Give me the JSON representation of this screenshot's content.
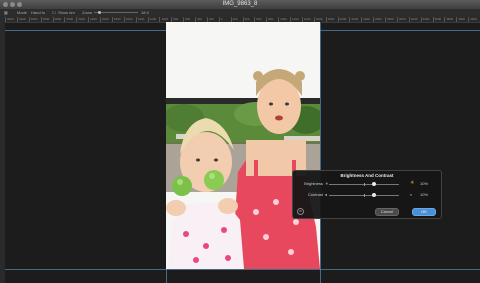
{
  "window": {
    "title": "IMG_9863_8"
  },
  "toolbar": {
    "mode_label": "Mode",
    "mode_value": "Hand to",
    "show_label": "Show rim",
    "zoom_label": "Zoom",
    "zoom_value": "18.9"
  },
  "ruler": {
    "ticks": [
      "3600",
      "3400",
      "3200",
      "3000",
      "2800",
      "2600",
      "2400",
      "2200",
      "2000",
      "1800",
      "1600",
      "1400",
      "1200",
      "1000",
      "800",
      "600",
      "400",
      "200",
      "0",
      "200",
      "400",
      "600",
      "800",
      "1000",
      "1200",
      "1400",
      "1600",
      "1800",
      "2000",
      "2200",
      "2400",
      "2600",
      "2800",
      "3000",
      "3200",
      "3400",
      "3600",
      "3800",
      "4000",
      "4200"
    ]
  },
  "dialog": {
    "title": "Brightness And Contrast",
    "brightness_label": "Brightness",
    "brightness_value": "10%",
    "contrast_label": "Contrast",
    "contrast_value": "10%",
    "cancel_label": "Cancel",
    "ok_label": "OK"
  },
  "colors": {
    "accent": "#4a90d6",
    "guide": "#5aa0d0",
    "canvas": "#1c1c1c"
  }
}
